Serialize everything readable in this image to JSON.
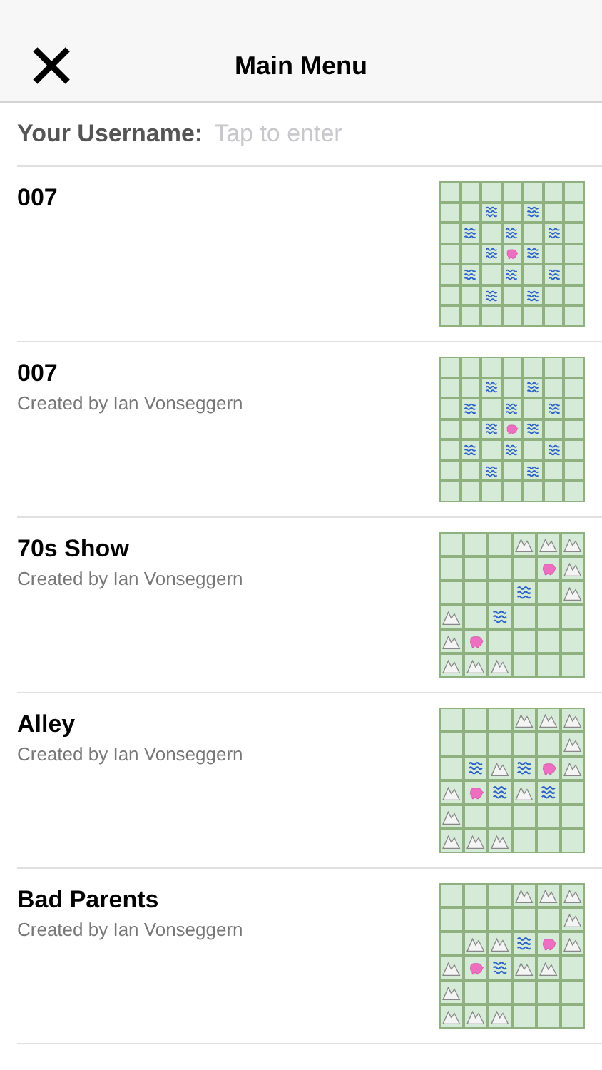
{
  "header": {
    "close": "✕",
    "title": "Main Menu"
  },
  "username": {
    "label": "Your Username:",
    "placeholder": "Tap to enter"
  },
  "levels": [
    {
      "title": "007",
      "rows": [
        [
          {
            "kind": "grass"
          },
          {
            "kind": "grass"
          },
          {
            "kind": "grass"
          },
          {
            "kind": "grass"
          },
          {
            "kind": "grass"
          },
          {
            "kind": "grass"
          },
          {
            "kind": "grass"
          }
        ],
        [
          {
            "kind": "grass"
          },
          {
            "kind": "grass"
          },
          {
            "kind": "water"
          },
          {
            "kind": "grass"
          },
          {
            "kind": "water"
          },
          {
            "kind": "grass"
          },
          {
            "kind": "grass"
          }
        ],
        [
          {
            "kind": "grass"
          },
          {
            "kind": "water"
          },
          {
            "kind": "grass"
          },
          {
            "kind": "water"
          },
          {
            "kind": "grass"
          },
          {
            "kind": "water"
          },
          {
            "kind": "grass"
          }
        ],
        [
          {
            "kind": "grass"
          },
          {
            "kind": "grass"
          },
          {
            "kind": "water"
          },
          {
            "kind": "pig"
          },
          {
            "kind": "water"
          },
          {
            "kind": "grass"
          },
          {
            "kind": "grass"
          }
        ],
        [
          {
            "kind": "grass"
          },
          {
            "kind": "water"
          },
          {
            "kind": "grass"
          },
          {
            "kind": "water"
          },
          {
            "kind": "grass"
          },
          {
            "kind": "water"
          },
          {
            "kind": "grass"
          }
        ],
        [
          {
            "kind": "grass"
          },
          {
            "kind": "grass"
          },
          {
            "kind": "water"
          },
          {
            "kind": "grass"
          },
          {
            "kind": "water"
          },
          {
            "kind": "grass"
          },
          {
            "kind": "grass"
          }
        ],
        [
          {
            "kind": "grass"
          },
          {
            "kind": "grass"
          },
          {
            "kind": "grass"
          },
          {
            "kind": "grass"
          },
          {
            "kind": "grass"
          },
          {
            "kind": "grass"
          },
          {
            "kind": "grass"
          }
        ]
      ]
    },
    {
      "title": "007",
      "author": "Created by Ian Vonseggern",
      "rows": [
        [
          {
            "kind": "grass"
          },
          {
            "kind": "grass"
          },
          {
            "kind": "grass"
          },
          {
            "kind": "grass"
          },
          {
            "kind": "grass"
          },
          {
            "kind": "grass"
          },
          {
            "kind": "grass"
          }
        ],
        [
          {
            "kind": "grass"
          },
          {
            "kind": "grass"
          },
          {
            "kind": "water"
          },
          {
            "kind": "grass"
          },
          {
            "kind": "water"
          },
          {
            "kind": "grass"
          },
          {
            "kind": "grass"
          }
        ],
        [
          {
            "kind": "grass"
          },
          {
            "kind": "water"
          },
          {
            "kind": "grass"
          },
          {
            "kind": "water"
          },
          {
            "kind": "grass"
          },
          {
            "kind": "water"
          },
          {
            "kind": "grass"
          }
        ],
        [
          {
            "kind": "grass"
          },
          {
            "kind": "grass"
          },
          {
            "kind": "water"
          },
          {
            "kind": "pig"
          },
          {
            "kind": "water"
          },
          {
            "kind": "grass"
          },
          {
            "kind": "grass"
          }
        ],
        [
          {
            "kind": "grass"
          },
          {
            "kind": "water"
          },
          {
            "kind": "grass"
          },
          {
            "kind": "water"
          },
          {
            "kind": "grass"
          },
          {
            "kind": "water"
          },
          {
            "kind": "grass"
          }
        ],
        [
          {
            "kind": "grass"
          },
          {
            "kind": "grass"
          },
          {
            "kind": "water"
          },
          {
            "kind": "grass"
          },
          {
            "kind": "water"
          },
          {
            "kind": "grass"
          },
          {
            "kind": "grass"
          }
        ],
        [
          {
            "kind": "grass"
          },
          {
            "kind": "grass"
          },
          {
            "kind": "grass"
          },
          {
            "kind": "grass"
          },
          {
            "kind": "grass"
          },
          {
            "kind": "grass"
          },
          {
            "kind": "grass"
          }
        ]
      ]
    },
    {
      "title": "70s Show",
      "author": "Created by Ian Vonseggern",
      "rows": [
        [
          {
            "kind": "grass"
          },
          {
            "kind": "grass"
          },
          {
            "kind": "grass"
          },
          {
            "kind": "mountain"
          },
          {
            "kind": "mountain"
          },
          {
            "kind": "mountain"
          }
        ],
        [
          {
            "kind": "grass"
          },
          {
            "kind": "grass"
          },
          {
            "kind": "grass"
          },
          {
            "kind": "grass"
          },
          {
            "kind": "pig"
          },
          {
            "kind": "mountain"
          }
        ],
        [
          {
            "kind": "grass"
          },
          {
            "kind": "grass"
          },
          {
            "kind": "grass"
          },
          {
            "kind": "water"
          },
          {
            "kind": "grass"
          },
          {
            "kind": "mountain"
          }
        ],
        [
          {
            "kind": "mountain"
          },
          {
            "kind": "grass"
          },
          {
            "kind": "water"
          },
          {
            "kind": "grass"
          },
          {
            "kind": "grass"
          },
          {
            "kind": "grass"
          }
        ],
        [
          {
            "kind": "mountain"
          },
          {
            "kind": "pig"
          },
          {
            "kind": "grass"
          },
          {
            "kind": "grass"
          },
          {
            "kind": "grass"
          },
          {
            "kind": "grass"
          }
        ],
        [
          {
            "kind": "mountain"
          },
          {
            "kind": "mountain"
          },
          {
            "kind": "mountain"
          },
          {
            "kind": "grass"
          },
          {
            "kind": "grass"
          },
          {
            "kind": "grass"
          }
        ]
      ]
    },
    {
      "title": "Alley",
      "author": "Created by Ian Vonseggern",
      "rows": [
        [
          {
            "kind": "grass"
          },
          {
            "kind": "grass"
          },
          {
            "kind": "grass"
          },
          {
            "kind": "mountain"
          },
          {
            "kind": "mountain"
          },
          {
            "kind": "mountain"
          }
        ],
        [
          {
            "kind": "grass"
          },
          {
            "kind": "grass"
          },
          {
            "kind": "grass"
          },
          {
            "kind": "grass"
          },
          {
            "kind": "grass"
          },
          {
            "kind": "mountain"
          }
        ],
        [
          {
            "kind": "grass"
          },
          {
            "kind": "water"
          },
          {
            "kind": "mountain"
          },
          {
            "kind": "water"
          },
          {
            "kind": "pig"
          },
          {
            "kind": "mountain"
          }
        ],
        [
          {
            "kind": "mountain"
          },
          {
            "kind": "pig"
          },
          {
            "kind": "water"
          },
          {
            "kind": "mountain"
          },
          {
            "kind": "water"
          },
          {
            "kind": "grass"
          }
        ],
        [
          {
            "kind": "mountain"
          },
          {
            "kind": "grass"
          },
          {
            "kind": "grass"
          },
          {
            "kind": "grass"
          },
          {
            "kind": "grass"
          },
          {
            "kind": "grass"
          }
        ],
        [
          {
            "kind": "mountain"
          },
          {
            "kind": "mountain"
          },
          {
            "kind": "mountain"
          },
          {
            "kind": "grass"
          },
          {
            "kind": "grass"
          },
          {
            "kind": "grass"
          }
        ]
      ]
    },
    {
      "title": "Bad Parents",
      "author": "Created by Ian Vonseggern",
      "rows": [
        [
          {
            "kind": "grass"
          },
          {
            "kind": "grass"
          },
          {
            "kind": "grass"
          },
          {
            "kind": "mountain"
          },
          {
            "kind": "mountain"
          },
          {
            "kind": "mountain"
          }
        ],
        [
          {
            "kind": "grass"
          },
          {
            "kind": "grass"
          },
          {
            "kind": "grass"
          },
          {
            "kind": "grass"
          },
          {
            "kind": "grass"
          },
          {
            "kind": "mountain"
          }
        ],
        [
          {
            "kind": "grass"
          },
          {
            "kind": "mountain"
          },
          {
            "kind": "mountain"
          },
          {
            "kind": "water"
          },
          {
            "kind": "pig"
          },
          {
            "kind": "mountain"
          }
        ],
        [
          {
            "kind": "mountain"
          },
          {
            "kind": "pig"
          },
          {
            "kind": "water"
          },
          {
            "kind": "mountain"
          },
          {
            "kind": "mountain"
          },
          {
            "kind": "grass"
          }
        ],
        [
          {
            "kind": "mountain"
          },
          {
            "kind": "grass"
          },
          {
            "kind": "grass"
          },
          {
            "kind": "grass"
          },
          {
            "kind": "grass"
          },
          {
            "kind": "grass"
          }
        ],
        [
          {
            "kind": "mountain"
          },
          {
            "kind": "mountain"
          },
          {
            "kind": "mountain"
          },
          {
            "kind": "grass"
          },
          {
            "kind": "grass"
          },
          {
            "kind": "grass"
          }
        ]
      ]
    }
  ]
}
